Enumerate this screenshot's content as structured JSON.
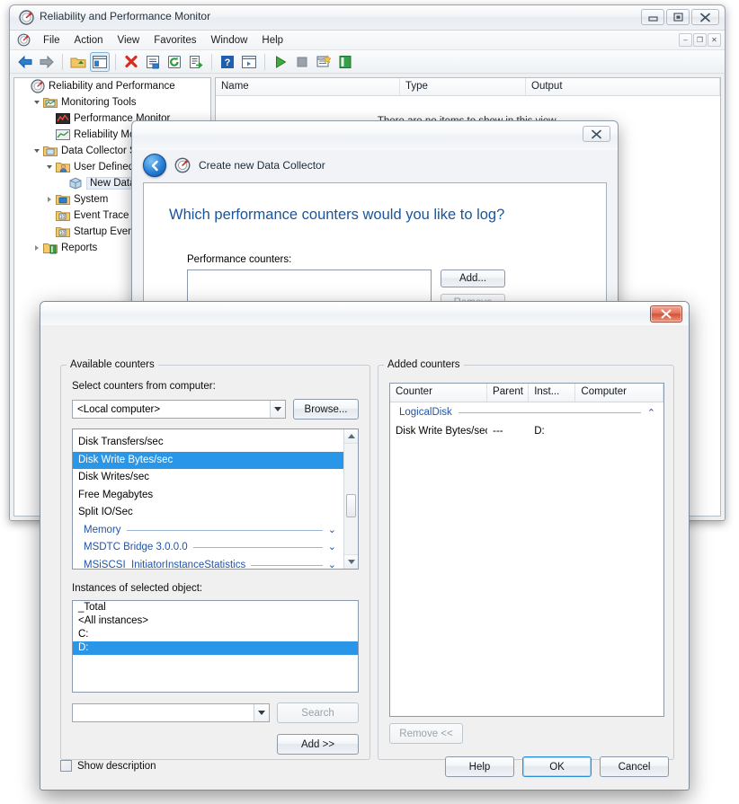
{
  "mmc": {
    "title": "Reliability and Performance Monitor",
    "title_icon": "perfmon-icon",
    "window_buttons": [
      {
        "name": "minimize-button",
        "glyph": "▭"
      },
      {
        "name": "maximize-button",
        "glyph": "❐"
      },
      {
        "name": "close-button",
        "glyph": "✖"
      }
    ],
    "menu": [
      "File",
      "Action",
      "View",
      "Favorites",
      "Window",
      "Help"
    ],
    "mdi_buttons": [
      {
        "name": "mdi-minimize-button",
        "glyph": "–"
      },
      {
        "name": "mdi-restore-button",
        "glyph": "❐"
      },
      {
        "name": "mdi-close-button",
        "glyph": "✕"
      }
    ],
    "toolbar": [
      {
        "name": "back-icon",
        "glyph": "back"
      },
      {
        "name": "forward-icon",
        "glyph": "forward"
      },
      {
        "name": "sep",
        "glyph": "sep"
      },
      {
        "name": "up-folder-icon",
        "glyph": "folder"
      },
      {
        "name": "show-hide-tree-icon",
        "glyph": "tree"
      },
      {
        "name": "sep",
        "glyph": "sep"
      },
      {
        "name": "delete-icon",
        "glyph": "delete"
      },
      {
        "name": "properties-icon",
        "glyph": "props"
      },
      {
        "name": "refresh-icon",
        "glyph": "refresh"
      },
      {
        "name": "export-list-icon",
        "glyph": "export"
      },
      {
        "name": "sep",
        "glyph": "sep"
      },
      {
        "name": "help-icon",
        "glyph": "help"
      },
      {
        "name": "show-window-icon",
        "glyph": "window"
      },
      {
        "name": "sep",
        "glyph": "sep"
      },
      {
        "name": "start-icon",
        "glyph": "play"
      },
      {
        "name": "stop-icon",
        "glyph": "stop"
      },
      {
        "name": "new-data-collector-icon",
        "glyph": "newdc"
      },
      {
        "name": "report-icon",
        "glyph": "report"
      }
    ],
    "tree": [
      {
        "label": "Reliability and Performance",
        "depth": 0,
        "twisty": "none",
        "icon": "perfmon-icon"
      },
      {
        "label": "Monitoring Tools",
        "depth": 1,
        "twisty": "open",
        "icon": "folder-chart-icon"
      },
      {
        "label": "Performance Monitor",
        "depth": 2,
        "twisty": "none",
        "icon": "perf-monitor-icon"
      },
      {
        "label": "Reliability Monitor",
        "depth": 2,
        "twisty": "none",
        "icon": "reliability-monitor-icon"
      },
      {
        "label": "Data Collector Sets",
        "depth": 1,
        "twisty": "open",
        "icon": "folder-sets-icon"
      },
      {
        "label": "User Defined",
        "depth": 2,
        "twisty": "open",
        "icon": "folder-user-icon"
      },
      {
        "label": "New Data Collector Set",
        "depth": 3,
        "twisty": "none",
        "icon": "collector-set-icon",
        "selected": true
      },
      {
        "label": "System",
        "depth": 2,
        "twisty": "closed",
        "icon": "folder-system-icon"
      },
      {
        "label": "Event Trace Sessions",
        "depth": 2,
        "twisty": "none",
        "icon": "folder-trace-icon"
      },
      {
        "label": "Startup Event Trace Sessions",
        "depth": 2,
        "twisty": "none",
        "icon": "folder-trace-icon"
      },
      {
        "label": "Reports",
        "depth": 1,
        "twisty": "closed",
        "icon": "folder-report-icon"
      }
    ],
    "list": {
      "columns": [
        "Name",
        "Type",
        "Output"
      ],
      "empty_text": "There are no items to show in this view."
    }
  },
  "wizard": {
    "title_text": "Create new Data Collector",
    "close_glyph": "✖",
    "back_glyph": "←",
    "heading": "Which performance counters would you like to log?",
    "counters_label": "Performance counters:",
    "add_button": "Add...",
    "remove_button": "Remove"
  },
  "add_counters": {
    "close_glyph": "✖",
    "available": {
      "legend": "Available counters",
      "select_label": "Select counters from computer:",
      "computer_value": "<Local computer>",
      "browse_button": "Browse...",
      "counters": [
        {
          "label": "Disk Transfers/sec",
          "kind": "item",
          "selected": false
        },
        {
          "label": "Disk Write Bytes/sec",
          "kind": "item",
          "selected": true
        },
        {
          "label": "Disk Writes/sec",
          "kind": "item",
          "selected": false
        },
        {
          "label": "Free Megabytes",
          "kind": "item",
          "selected": false
        },
        {
          "label": "Split IO/Sec",
          "kind": "item",
          "selected": false
        },
        {
          "label": "Memory",
          "kind": "group",
          "chevron": "⌄"
        },
        {
          "label": "MSDTC Bridge 3.0.0.0",
          "kind": "group",
          "chevron": "⌄"
        },
        {
          "label": "MSiSCSI_InitiatorInstanceStatistics",
          "kind": "group",
          "chevron": "⌄"
        }
      ],
      "instances_label": "Instances of selected object:",
      "instances": [
        {
          "label": "_Total",
          "selected": false
        },
        {
          "label": "<All instances>",
          "selected": false
        },
        {
          "label": "C:",
          "selected": false
        },
        {
          "label": "D:",
          "selected": true
        }
      ],
      "search_value": "",
      "search_button": "Search",
      "add_button": "Add >>"
    },
    "added": {
      "legend": "Added counters",
      "columns": [
        "Counter",
        "Parent",
        "Inst...",
        "Computer"
      ],
      "rows": [
        {
          "kind": "group",
          "counter": "LogicalDisk",
          "chevron": "⌃"
        },
        {
          "kind": "item",
          "counter": "Disk Write Bytes/sec",
          "parent": "---",
          "instance": "D:",
          "computer": ""
        }
      ],
      "remove_button": "Remove <<"
    },
    "show_description_label": "Show description",
    "show_description_checked": false,
    "footer_buttons": [
      {
        "name": "help-button",
        "label": "Help",
        "focused": false
      },
      {
        "name": "ok-button",
        "label": "OK",
        "focused": true
      },
      {
        "name": "cancel-button",
        "label": "Cancel",
        "focused": false
      }
    ]
  },
  "colors": {
    "selection_blue": "#2a96e8",
    "link_blue": "#2254a6",
    "heading_blue": "#18559c",
    "close_red": "#d2523a",
    "focus_blue": "#2c8fd6"
  }
}
